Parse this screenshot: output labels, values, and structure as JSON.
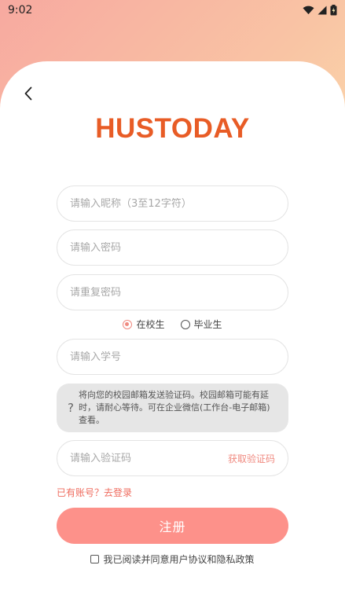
{
  "status_bar": {
    "time": "9:02"
  },
  "app": {
    "logo": "HUSTODAY"
  },
  "form": {
    "nickname_placeholder": "请输入昵称（3至12字符）",
    "password_placeholder": "请输入密码",
    "confirm_password_placeholder": "请重复密码",
    "student_type": {
      "options": [
        "在校生",
        "毕业生"
      ],
      "selected": "在校生"
    },
    "student_id_placeholder": "请输入学号",
    "notice_text": "将向您的校园邮箱发送验证码。校园邮箱可能有延时，请耐心等待。可在企业微信(工作台-电子邮箱)查看。",
    "code_placeholder": "请输入验证码",
    "get_code_label": "获取验证码",
    "login_link": "已有账号？去登录",
    "register_label": "注册",
    "agreement_text": "我已阅读并同意用户协议和隐私政策",
    "agreement_checked": false
  },
  "colors": {
    "brand": "#e85c26",
    "accent": "#fd918a",
    "link": "#ef6b5e"
  }
}
